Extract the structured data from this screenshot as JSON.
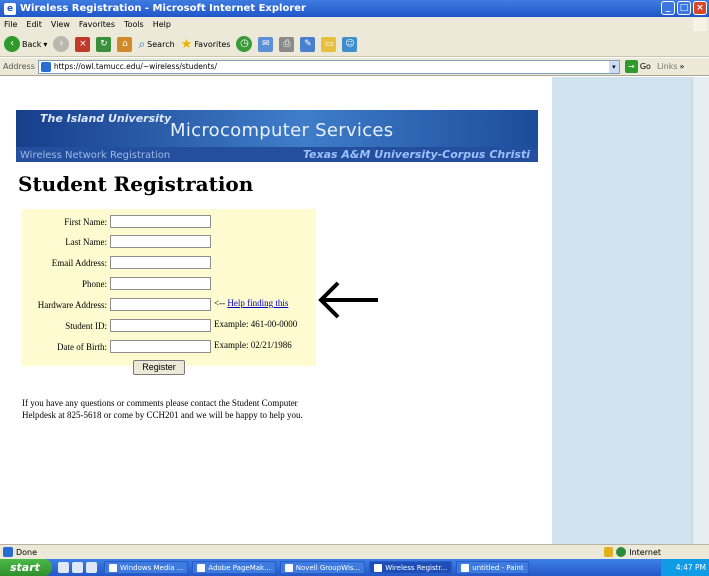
{
  "window": {
    "title": "Wireless Registration - Microsoft Internet Explorer"
  },
  "menu": [
    "File",
    "Edit",
    "View",
    "Favorites",
    "Tools",
    "Help"
  ],
  "toolbar": {
    "back": "Back",
    "search": "Search",
    "favorites": "Favorites"
  },
  "address": {
    "label": "Address",
    "url": "https://owl.tamucc.edu/~wireless/students/",
    "go": "Go",
    "links": "Links"
  },
  "banner": {
    "tagline": "The Island University",
    "title": "Microcomputer Services",
    "subtitle": "Wireless Network Registration",
    "org": "Texas A&M University-Corpus Christi"
  },
  "page": {
    "heading": "Student Registration"
  },
  "form": {
    "fields": [
      {
        "label": "First Name:",
        "value": ""
      },
      {
        "label": "Last Name:",
        "value": ""
      },
      {
        "label": "Email Address:",
        "value": ""
      },
      {
        "label": "Phone:",
        "value": ""
      },
      {
        "label": "Hardware Address:",
        "value": ""
      },
      {
        "label": "Student ID:",
        "value": ""
      },
      {
        "label": "Date of Birth:",
        "value": ""
      }
    ],
    "hardware_hint_prefix": "<-- ",
    "hardware_hint_link": "Help finding this",
    "student_id_example": "Example: 461-00-0000",
    "dob_example": "Example: 02/21/1986",
    "submit": "Register"
  },
  "help_text": "If you have any questions or comments please contact the Student Computer Helpdesk at 825-5618 or come by CCH201 and we will be happy to help you.",
  "status": {
    "left": "Done",
    "zone": "Internet"
  },
  "taskbar": {
    "start": "start",
    "tasks": [
      "Windows Media ...",
      "Adobe PageMak...",
      "Novell GroupWis...",
      "Wireless Registr...",
      "untitled - Paint"
    ],
    "clock": "4:47 PM"
  }
}
